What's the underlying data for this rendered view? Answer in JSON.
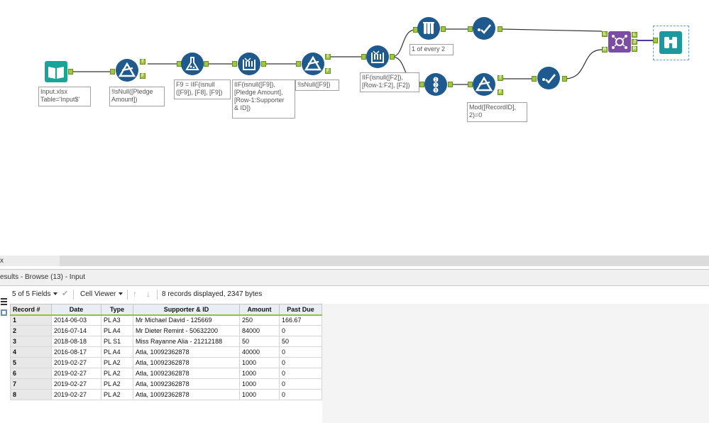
{
  "canvas": {
    "annotations": {
      "input": "Input.xlsx\nTable='Input$'",
      "filter1": "!IsNull([Pledge\nAmount])",
      "formula": "F9 = IIF(isnull\n([F9]), [F8], [F9])",
      "multirow1": "IIF(isnull([F9]),\n[Pledge Amount],\n[Row-1:Supporter\n& ID])",
      "filter2": "!IsNull([F9])",
      "multirow2": "IIF(isnull([F2]),\n[Row-1:F2], [F2])",
      "sample": "1 of every 2",
      "filter3": "Mod([RecordID],\n2)=0"
    },
    "anchor_labels": {
      "t": "T",
      "f": "F",
      "l": "L",
      "j": "J",
      "r": "R"
    }
  },
  "splitter": {
    "close_glyph": "x"
  },
  "results": {
    "title": "esults - Browse (13) - Input"
  },
  "toolbar": {
    "fields": "5 of 5 Fields",
    "viewer": "Cell Viewer",
    "summary": "8 records displayed, 2347 bytes",
    "up_arrow": "↑",
    "down_arrow": "↓",
    "check": "✔"
  },
  "grid": {
    "headers": [
      "Record #",
      "Date",
      "Type",
      "Supporter & ID",
      "Amount",
      "Past Due"
    ],
    "rows": [
      [
        "1",
        "2014-06-03",
        "PL A3",
        "Mr Michael David - 125669",
        "250",
        "166.67"
      ],
      [
        "2",
        "2016-07-14",
        "PL A4",
        "Mr Dieter Remint - 50632200",
        "84000",
        "0"
      ],
      [
        "3",
        "2018-08-18",
        "PL S1",
        "Miss Rayanne Alia - 21212188",
        "50",
        "50"
      ],
      [
        "4",
        "2016-08-17",
        "PL A4",
        "Atla, 10092362878",
        "40000",
        "0"
      ],
      [
        "5",
        "2019-02-27",
        "PL A2",
        "Atla, 10092362878",
        "1000",
        "0"
      ],
      [
        "6",
        "2019-02-27",
        "PL A2",
        "Atla, 10092362878",
        "1000",
        "0"
      ],
      [
        "7",
        "2019-02-27",
        "PL A2",
        "Atla, 10092362878",
        "1000",
        "0"
      ],
      [
        "8",
        "2019-02-27",
        "PL A2",
        "Atla, 10092362878",
        "1000",
        "0"
      ]
    ]
  },
  "colors": {
    "tool_blue": "#1e5a8e",
    "input_teal": "#17a59a",
    "join_purple": "#7b4ea3",
    "browse_teal": "#1a9aa0",
    "anchor_green": "#9ec73d"
  }
}
